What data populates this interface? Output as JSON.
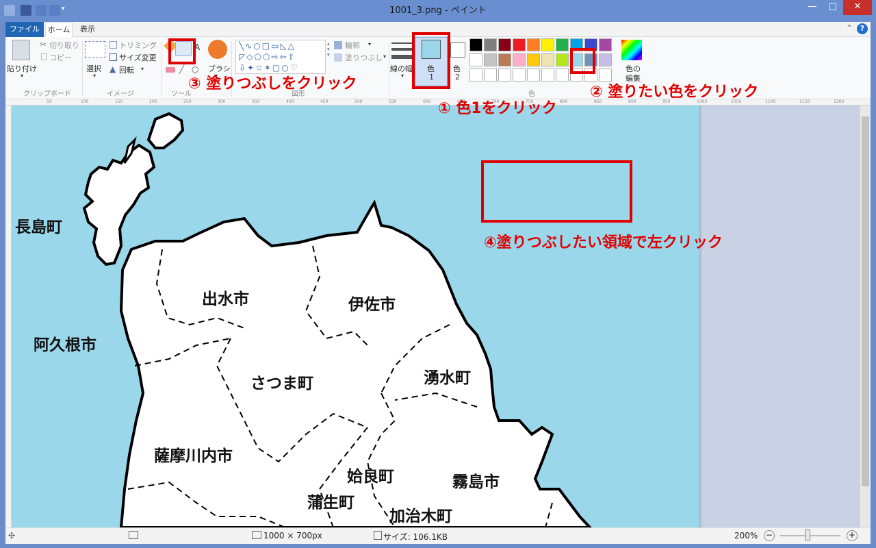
{
  "window": {
    "title": "1001_3.png - ペイント"
  },
  "tabs": {
    "file": "ファイル",
    "home": "ホーム",
    "view": "表示"
  },
  "clipboard": {
    "paste": "貼り付け",
    "cut": "切り取り",
    "copy": "コピー",
    "group": "クリップボード"
  },
  "image": {
    "select": "選択",
    "crop": "トリミング",
    "resize": "サイズ変更",
    "rotate": "回転",
    "group": "イメージ"
  },
  "tools": {
    "group": "ツール"
  },
  "brush": {
    "label": "ブラシ"
  },
  "shapes": {
    "outline": "輪郭",
    "fill": "塗りつぶし",
    "group": "図形"
  },
  "size": {
    "label": "線の幅"
  },
  "colors": {
    "color1": "色",
    "color1_num": "1",
    "color2": "色",
    "color2_num": "2",
    "edit": "色の",
    "edit2": "編集",
    "group": "色",
    "color1_value": "#9bd7ea",
    "color2_value": "#ffffff",
    "palette_row1": [
      "#000000",
      "#7f7f7f",
      "#880015",
      "#ed1c24",
      "#ff7f27",
      "#fff200",
      "#22b14c",
      "#00a2e8",
      "#3f48cc",
      "#a349a4"
    ],
    "palette_row2": [
      "#ffffff",
      "#c3c3c3",
      "#b97a57",
      "#ffaec9",
      "#ffc90e",
      "#efe4b0",
      "#b5e61d",
      "#9bd7ea",
      "#7092be",
      "#c8bfe7"
    ]
  },
  "ruler": {
    "ticks": [
      "50",
      "100",
      "150",
      "200",
      "250",
      "300",
      "350",
      "400",
      "450",
      "500",
      "550",
      "600",
      "650",
      "700",
      "750",
      "800",
      "850",
      "900",
      "950",
      "1000",
      "1050",
      "1100",
      "1150",
      "1200"
    ]
  },
  "annotations": {
    "step1": "① 色1をクリック",
    "step2": "② 塗りたい色をクリック",
    "step3": "③ 塗りつぶしをクリック",
    "step4": "④塗りつぶしたい領域で左クリック"
  },
  "map": {
    "labels": [
      "長島町",
      "阿久根市",
      "出水市",
      "伊佐市",
      "さつま町",
      "湧水町",
      "薩摩川内市",
      "姶良町",
      "霧島市",
      "蒲生町",
      "加治木町"
    ]
  },
  "status": {
    "dimensions": "1000 × 700px",
    "filesize": "サイズ: 106.1KB",
    "zoom": "200%",
    "zoom_level": 0.45
  }
}
